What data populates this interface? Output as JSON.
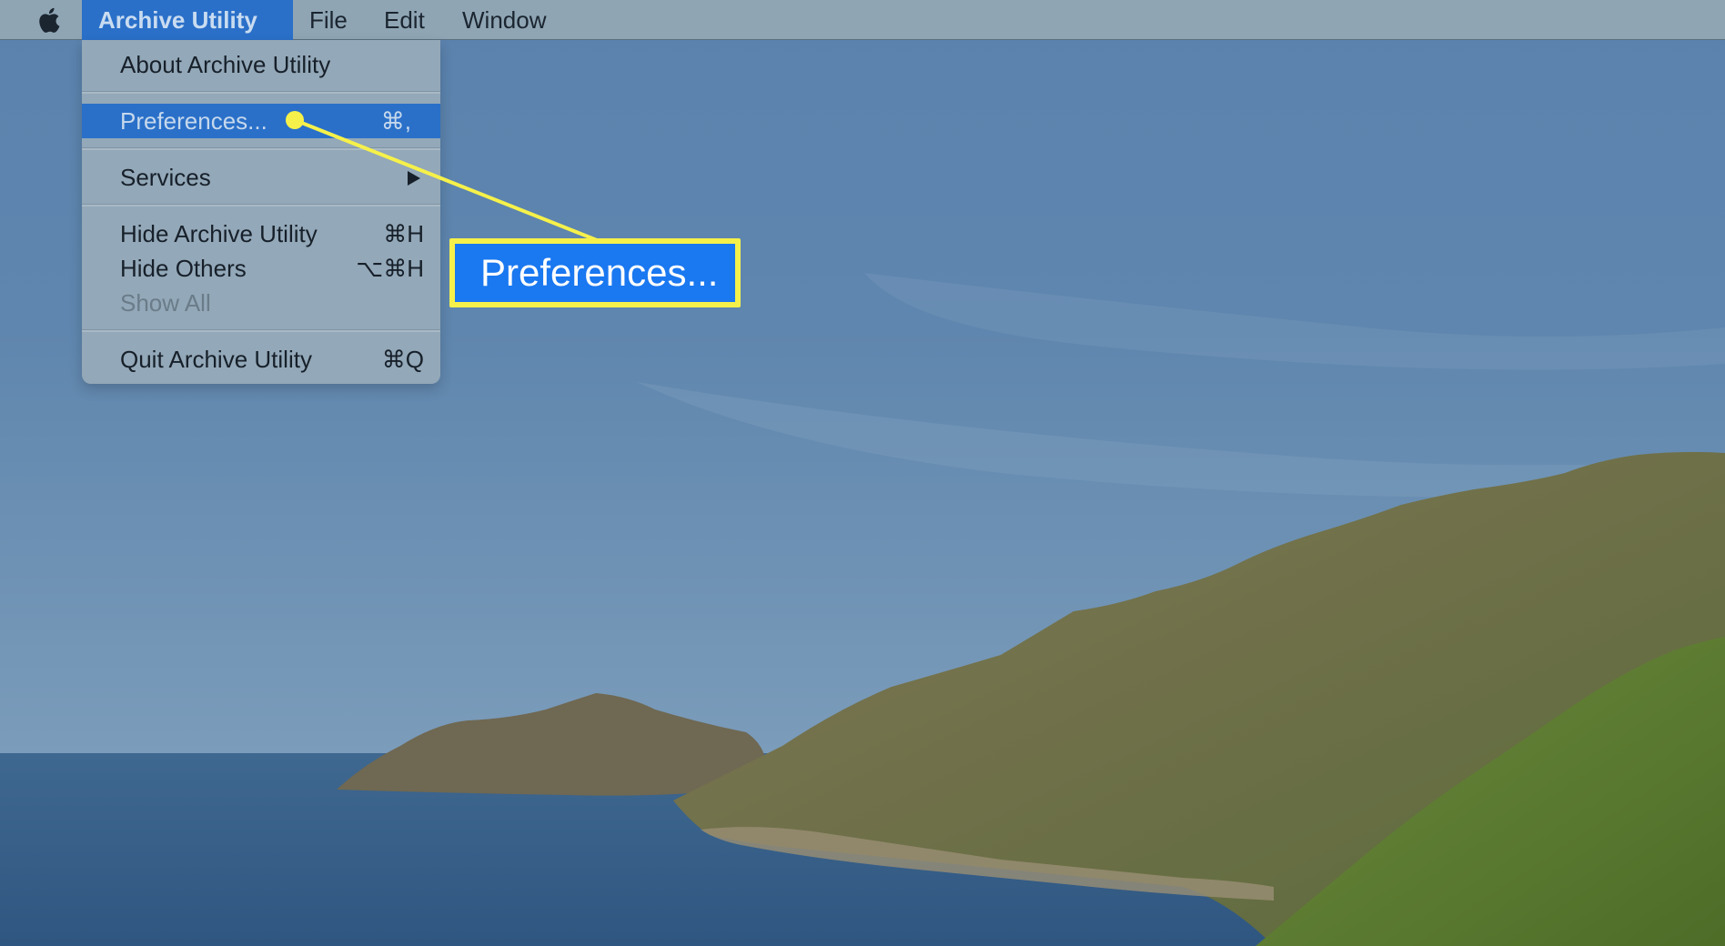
{
  "menubar": {
    "apple_icon": "apple-logo-icon",
    "app_name": "Archive Utility",
    "file": "File",
    "edit": "Edit",
    "window": "Window"
  },
  "dropdown": {
    "about": "About Archive Utility",
    "preferences": {
      "label": "Preferences...",
      "shortcut": "⌘,"
    },
    "services": {
      "label": "Services",
      "icon": "submenu-arrow-icon"
    },
    "hide_app": {
      "label": "Hide Archive Utility",
      "shortcut": "⌘H"
    },
    "hide_others": {
      "label": "Hide Others",
      "shortcut": "⌥⌘H"
    },
    "show_all": {
      "label": "Show All"
    },
    "quit": {
      "label": "Quit Archive Utility",
      "shortcut": "⌘Q"
    }
  },
  "callout": {
    "label": "Preferences...",
    "highlight_color": "#f6f14a",
    "box_color": "#1a78f0"
  },
  "colors": {
    "accent": "#2a70c9",
    "menubar": "#8fa5b4",
    "menu": "#93a8b8"
  }
}
